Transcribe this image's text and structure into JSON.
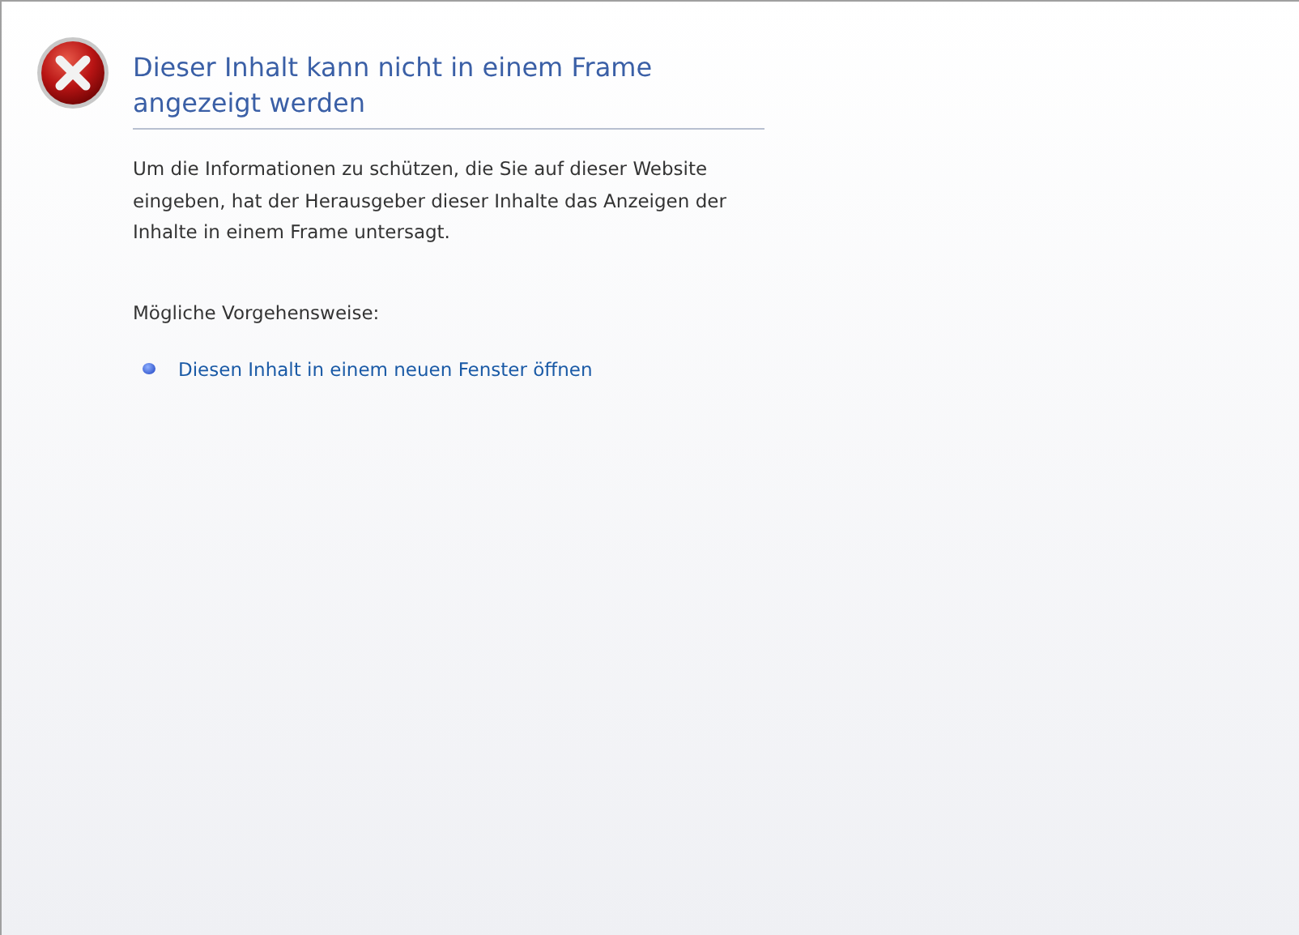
{
  "title": "Dieser Inhalt kann nicht in einem Frame angezeigt werden",
  "message": "Um die Informationen zu schützen, die Sie auf dieser Website eingeben, hat der Herausgeber dieser Inhalte das Anzeigen der Inhalte in einem Frame untersagt.",
  "options_heading": "Mögliche Vorgehensweise:",
  "options": [
    {
      "label": "Diesen Inhalt in einem neuen Fenster öffnen"
    }
  ]
}
